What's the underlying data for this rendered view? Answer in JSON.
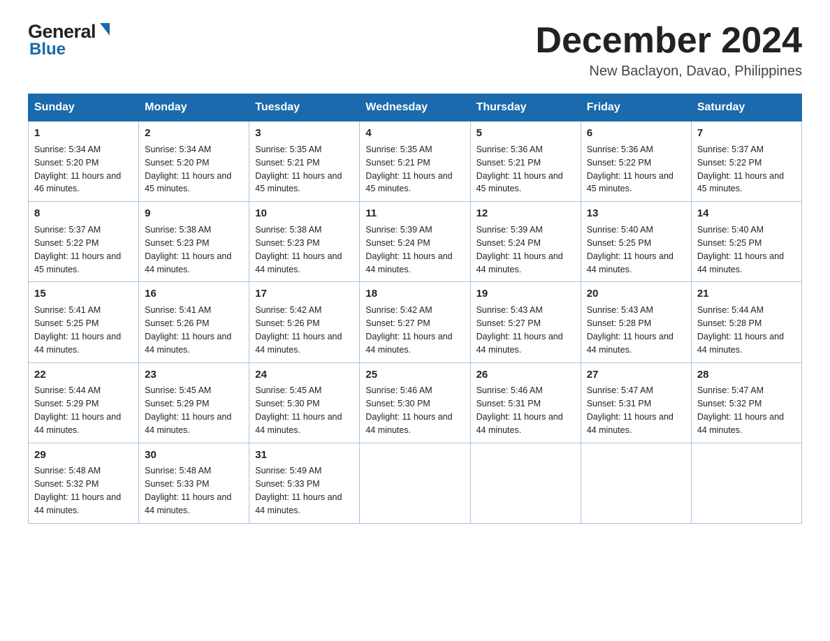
{
  "header": {
    "logo": {
      "general": "General",
      "blue": "Blue"
    },
    "title": "December 2024",
    "location": "New Baclayon, Davao, Philippines"
  },
  "calendar": {
    "days": [
      "Sunday",
      "Monday",
      "Tuesday",
      "Wednesday",
      "Thursday",
      "Friday",
      "Saturday"
    ],
    "weeks": [
      [
        {
          "num": "1",
          "sunrise": "5:34 AM",
          "sunset": "5:20 PM",
          "daylight": "11 hours and 46 minutes."
        },
        {
          "num": "2",
          "sunrise": "5:34 AM",
          "sunset": "5:20 PM",
          "daylight": "11 hours and 45 minutes."
        },
        {
          "num": "3",
          "sunrise": "5:35 AM",
          "sunset": "5:21 PM",
          "daylight": "11 hours and 45 minutes."
        },
        {
          "num": "4",
          "sunrise": "5:35 AM",
          "sunset": "5:21 PM",
          "daylight": "11 hours and 45 minutes."
        },
        {
          "num": "5",
          "sunrise": "5:36 AM",
          "sunset": "5:21 PM",
          "daylight": "11 hours and 45 minutes."
        },
        {
          "num": "6",
          "sunrise": "5:36 AM",
          "sunset": "5:22 PM",
          "daylight": "11 hours and 45 minutes."
        },
        {
          "num": "7",
          "sunrise": "5:37 AM",
          "sunset": "5:22 PM",
          "daylight": "11 hours and 45 minutes."
        }
      ],
      [
        {
          "num": "8",
          "sunrise": "5:37 AM",
          "sunset": "5:22 PM",
          "daylight": "11 hours and 45 minutes."
        },
        {
          "num": "9",
          "sunrise": "5:38 AM",
          "sunset": "5:23 PM",
          "daylight": "11 hours and 44 minutes."
        },
        {
          "num": "10",
          "sunrise": "5:38 AM",
          "sunset": "5:23 PM",
          "daylight": "11 hours and 44 minutes."
        },
        {
          "num": "11",
          "sunrise": "5:39 AM",
          "sunset": "5:24 PM",
          "daylight": "11 hours and 44 minutes."
        },
        {
          "num": "12",
          "sunrise": "5:39 AM",
          "sunset": "5:24 PM",
          "daylight": "11 hours and 44 minutes."
        },
        {
          "num": "13",
          "sunrise": "5:40 AM",
          "sunset": "5:25 PM",
          "daylight": "11 hours and 44 minutes."
        },
        {
          "num": "14",
          "sunrise": "5:40 AM",
          "sunset": "5:25 PM",
          "daylight": "11 hours and 44 minutes."
        }
      ],
      [
        {
          "num": "15",
          "sunrise": "5:41 AM",
          "sunset": "5:25 PM",
          "daylight": "11 hours and 44 minutes."
        },
        {
          "num": "16",
          "sunrise": "5:41 AM",
          "sunset": "5:26 PM",
          "daylight": "11 hours and 44 minutes."
        },
        {
          "num": "17",
          "sunrise": "5:42 AM",
          "sunset": "5:26 PM",
          "daylight": "11 hours and 44 minutes."
        },
        {
          "num": "18",
          "sunrise": "5:42 AM",
          "sunset": "5:27 PM",
          "daylight": "11 hours and 44 minutes."
        },
        {
          "num": "19",
          "sunrise": "5:43 AM",
          "sunset": "5:27 PM",
          "daylight": "11 hours and 44 minutes."
        },
        {
          "num": "20",
          "sunrise": "5:43 AM",
          "sunset": "5:28 PM",
          "daylight": "11 hours and 44 minutes."
        },
        {
          "num": "21",
          "sunrise": "5:44 AM",
          "sunset": "5:28 PM",
          "daylight": "11 hours and 44 minutes."
        }
      ],
      [
        {
          "num": "22",
          "sunrise": "5:44 AM",
          "sunset": "5:29 PM",
          "daylight": "11 hours and 44 minutes."
        },
        {
          "num": "23",
          "sunrise": "5:45 AM",
          "sunset": "5:29 PM",
          "daylight": "11 hours and 44 minutes."
        },
        {
          "num": "24",
          "sunrise": "5:45 AM",
          "sunset": "5:30 PM",
          "daylight": "11 hours and 44 minutes."
        },
        {
          "num": "25",
          "sunrise": "5:46 AM",
          "sunset": "5:30 PM",
          "daylight": "11 hours and 44 minutes."
        },
        {
          "num": "26",
          "sunrise": "5:46 AM",
          "sunset": "5:31 PM",
          "daylight": "11 hours and 44 minutes."
        },
        {
          "num": "27",
          "sunrise": "5:47 AM",
          "sunset": "5:31 PM",
          "daylight": "11 hours and 44 minutes."
        },
        {
          "num": "28",
          "sunrise": "5:47 AM",
          "sunset": "5:32 PM",
          "daylight": "11 hours and 44 minutes."
        }
      ],
      [
        {
          "num": "29",
          "sunrise": "5:48 AM",
          "sunset": "5:32 PM",
          "daylight": "11 hours and 44 minutes."
        },
        {
          "num": "30",
          "sunrise": "5:48 AM",
          "sunset": "5:33 PM",
          "daylight": "11 hours and 44 minutes."
        },
        {
          "num": "31",
          "sunrise": "5:49 AM",
          "sunset": "5:33 PM",
          "daylight": "11 hours and 44 minutes."
        },
        null,
        null,
        null,
        null
      ]
    ]
  }
}
